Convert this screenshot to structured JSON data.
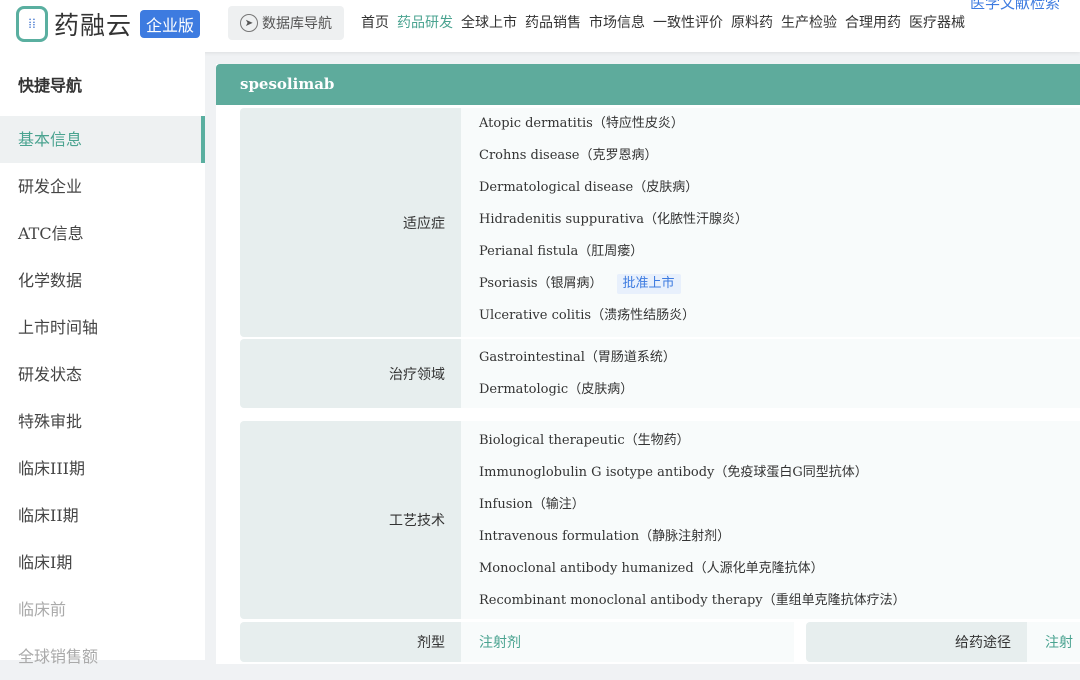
{
  "header": {
    "logo": "药融云",
    "edition": "企业版",
    "db_nav": "数据库导航",
    "menu": [
      "首页",
      "药品研发",
      "全球上市",
      "药品销售",
      "市场信息",
      "一致性评价",
      "原料药",
      "生产检验",
      "合理用药",
      "医疗器械"
    ],
    "active_menu": "药品研发",
    "cut_link": "医学文献检索"
  },
  "sidebar": {
    "title": "快捷导航",
    "items": [
      "基本信息",
      "研发企业",
      "ATC信息",
      "化学数据",
      "上市时间轴",
      "研发状态",
      "特殊审批",
      "临床III期",
      "临床II期",
      "临床I期",
      "临床前",
      "全球销售额"
    ]
  },
  "drug": {
    "name": "spesolimab",
    "indication_label": "适应症",
    "indications": [
      "Atopic dermatitis（特应性皮炎）",
      "Crohns disease（克罗恩病）",
      "Dermatological disease（皮肤病）",
      "Hidradenitis suppurativa（化脓性汗腺炎）",
      "Perianal fistula（肛周瘘）",
      "Psoriasis（银屑病）",
      "Ulcerative colitis（溃疡性结肠炎）"
    ],
    "approved_tag": "批准上市",
    "area_label": "治疗领域",
    "areas": [
      "Gastrointestinal（胃肠道系统）",
      "Dermatologic（皮肤病）"
    ],
    "tech_label": "工艺技术",
    "techs": [
      "Biological therapeutic（生物药）",
      "Immunoglobulin G isotype antibody（免疫球蛋白G同型抗体）",
      "Infusion（输注）",
      "Intravenous formulation（静脉注射剂）",
      "Monoclonal antibody humanized（人源化单克隆抗体）",
      "Recombinant monoclonal antibody therapy（重组单克隆抗体疗法）"
    ],
    "form_label": "剂型",
    "form": "注射剂",
    "route_label": "给药途径",
    "route": "注射"
  }
}
